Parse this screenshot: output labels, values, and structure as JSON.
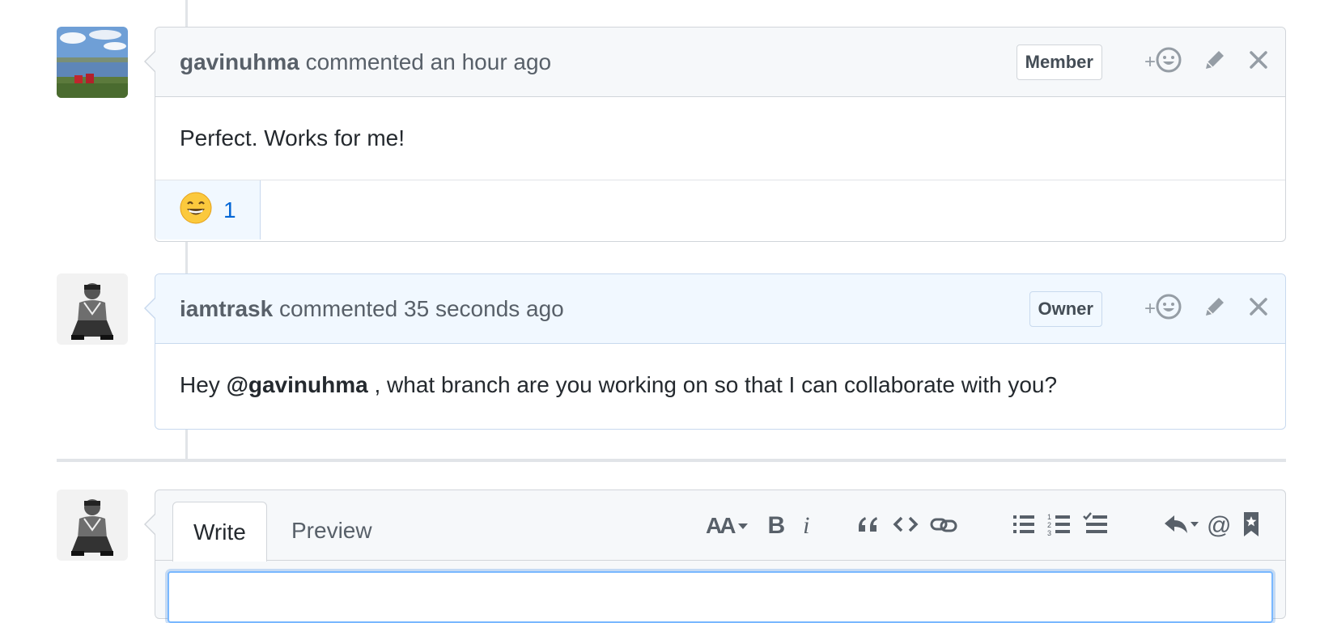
{
  "comments": [
    {
      "author": "gavinuhma",
      "action": " commented ",
      "time": "an hour ago",
      "badge": "Member",
      "body": "Perfect. Works for me!",
      "reactions": [
        {
          "emoji": "😄",
          "count": "1"
        }
      ]
    },
    {
      "author": "iamtrask",
      "action": " commented ",
      "time": "35 seconds ago",
      "badge": "Owner",
      "body_prefix": "Hey ",
      "body_mention": "@gavinuhma",
      "body_suffix": " , what branch are you working on so that I can collaborate with you?"
    }
  ],
  "header_icons": {
    "add_reaction": "+",
    "add_reaction_icon": "smiley-icon",
    "edit_icon": "pencil-icon",
    "delete_icon": "close-icon"
  },
  "composer": {
    "tabs": {
      "write": "Write",
      "preview": "Preview"
    },
    "toolbar": {
      "header": "AA",
      "bold": "B",
      "italic": "i",
      "quote": "“",
      "code": "<>",
      "link": "link-icon",
      "bulleted_list": "list-unordered-icon",
      "numbered_list": "list-ordered-icon",
      "task_list": "tasklist-icon",
      "reply": "reply-icon",
      "mention": "@",
      "saved_reply": "bookmark-icon"
    }
  },
  "colors": {
    "link": "#0366d6",
    "owner_header": "#f1f8ff",
    "member_header": "#f6f8fa",
    "border": "#d1d5da"
  }
}
